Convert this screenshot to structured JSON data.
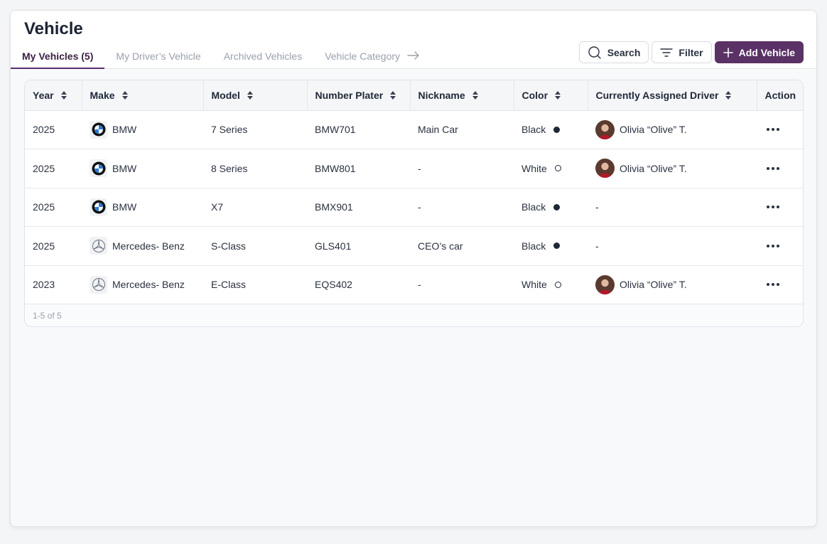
{
  "page": {
    "title": "Vehicle"
  },
  "tabs": [
    {
      "label": "My Vehicles (5)",
      "active": true
    },
    {
      "label": "My Driver’s Vehicle",
      "active": false
    },
    {
      "label": "Archived Vehicles",
      "active": false
    },
    {
      "label": "Vehicle Category",
      "active": false
    }
  ],
  "toolbar": {
    "search_label": "Search",
    "filter_label": "Filter",
    "add_label": "Add Vehicle"
  },
  "table": {
    "columns": [
      "Year",
      "Make",
      "Model",
      "Number Plater",
      "Nickname",
      "Color",
      "Currently Assigned Driver",
      "Action"
    ],
    "rows": [
      {
        "year": "2025",
        "make": "BMW",
        "make_logo": "bmw-logo-icon",
        "model": "7 Series",
        "plate": "BMW701",
        "nickname": "Main Car",
        "color": "Black",
        "color_style": "filled",
        "driver": "Olivia “Olive” T.",
        "has_avatar": true
      },
      {
        "year": "2025",
        "make": "BMW",
        "make_logo": "bmw-logo-icon",
        "model": "8 Series",
        "plate": "BMW801",
        "nickname": "-",
        "color": "White",
        "color_style": "hollow",
        "driver": "Olivia “Olive” T.",
        "has_avatar": true
      },
      {
        "year": "2025",
        "make": "BMW",
        "make_logo": "bmw-logo-icon",
        "model": "X7",
        "plate": "BMX901",
        "nickname": "-",
        "color": "Black",
        "color_style": "filled",
        "driver": "-",
        "has_avatar": false
      },
      {
        "year": "2025",
        "make": "Mercedes- Benz",
        "make_logo": "mercedes-logo-icon",
        "model": "S-Class",
        "plate": "GLS401",
        "nickname": "CEO’s car",
        "color": "Black",
        "color_style": "filled",
        "driver": "-",
        "has_avatar": false
      },
      {
        "year": "2023",
        "make": "Mercedes- Benz",
        "make_logo": "mercedes-logo-icon",
        "model": "E-Class",
        "plate": "EQS402",
        "nickname": "-",
        "color": "White",
        "color_style": "hollow",
        "driver": "Olivia “Olive” T.",
        "has_avatar": true
      }
    ],
    "footer": "1-5 of 5"
  },
  "colors": {
    "brand": "#5b3266",
    "active_tab": "#3b1f45",
    "muted_text": "#9aa0ab"
  }
}
